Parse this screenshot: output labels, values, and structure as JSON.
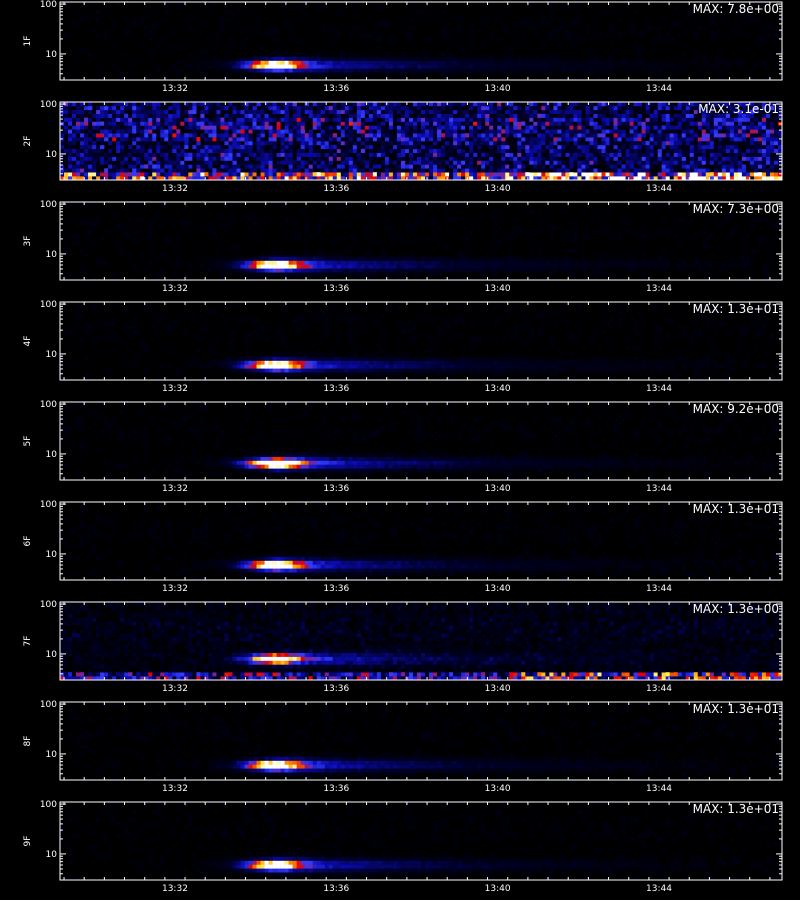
{
  "chart_data": {
    "type": "heatmap",
    "x_tick_labels": [
      "13:32",
      "13:36",
      "13:40",
      "13:44"
    ],
    "x_ticks_min": [
      31.75,
      35.75,
      39.75,
      43.75
    ],
    "x_range_min": [
      28.9,
      46.8
    ],
    "y_tick_labels": [
      "10",
      "100"
    ],
    "y_scale": "log",
    "y_range": [
      3,
      110
    ],
    "xlabel": "",
    "colormap": [
      "#000000",
      "#000033",
      "#0000aa",
      "#3333ff",
      "#ff0000",
      "#ff9900",
      "#ffff66",
      "#ffffff"
    ],
    "panels": [
      {
        "name": "1F",
        "max": "MAX: 7.8e+00",
        "burst_center_min": 34.2,
        "burst_y": 6,
        "burst_strength": 1.0,
        "noise": 0.05,
        "bottom_noise": 0.0
      },
      {
        "name": "2F",
        "max": "MAX: 3.1e-01",
        "burst_center_min": 0,
        "burst_y": 6,
        "burst_strength": 0.0,
        "noise": 0.55,
        "bottom_noise": 0.9
      },
      {
        "name": "3F",
        "max": "MAX: 7.3e+00",
        "burst_center_min": 34.2,
        "burst_y": 6,
        "burst_strength": 1.0,
        "noise": 0.05,
        "bottom_noise": 0.0
      },
      {
        "name": "4F",
        "max": "MAX: 1.3e+01",
        "burst_center_min": 34.2,
        "burst_y": 6,
        "burst_strength": 1.0,
        "noise": 0.05,
        "bottom_noise": 0.0
      },
      {
        "name": "5F",
        "max": "MAX: 9.2e+00",
        "burst_center_min": 34.2,
        "burst_y": 6.5,
        "burst_strength": 1.1,
        "noise": 0.05,
        "bottom_noise": 0.0
      },
      {
        "name": "6F",
        "max": "MAX: 1.3e+01",
        "burst_center_min": 34.2,
        "burst_y": 6,
        "burst_strength": 1.0,
        "noise": 0.05,
        "bottom_noise": 0.0
      },
      {
        "name": "7F",
        "max": "MAX: 1.3e+00",
        "burst_center_min": 34.2,
        "burst_y": 8,
        "burst_strength": 0.9,
        "noise": 0.15,
        "bottom_noise": 0.7
      },
      {
        "name": "8F",
        "max": "MAX: 1.3e+01",
        "burst_center_min": 34.2,
        "burst_y": 6,
        "burst_strength": 1.0,
        "noise": 0.05,
        "bottom_noise": 0.0
      },
      {
        "name": "9F",
        "max": "MAX: 1.3e+01",
        "burst_center_min": 34.2,
        "burst_y": 6,
        "burst_strength": 1.0,
        "noise": 0.05,
        "bottom_noise": 0.0
      }
    ]
  }
}
